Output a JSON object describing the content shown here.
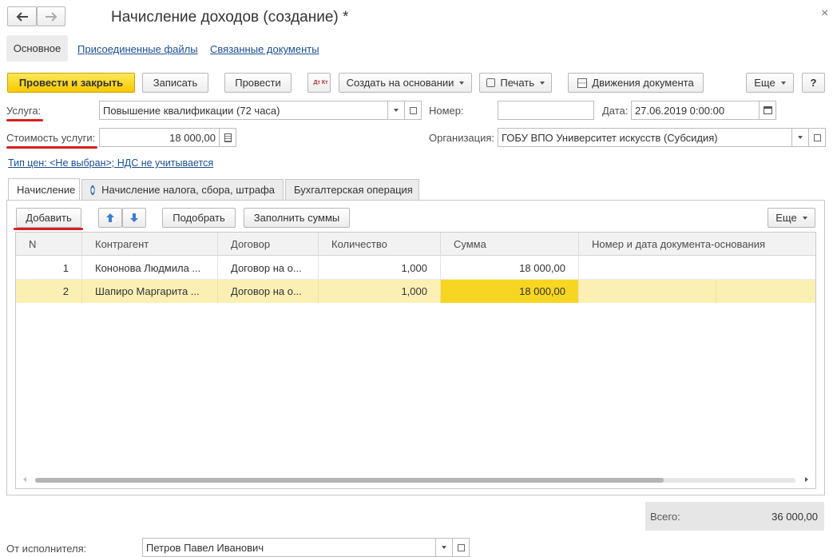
{
  "window": {
    "title": "Начисление доходов (создание) *",
    "back_icon": "arrow-left-icon",
    "forward_icon": "arrow-right-icon",
    "close_icon": "close-icon"
  },
  "nav_tabs": [
    "Основное",
    "Присоединенные файлы",
    "Связанные документы"
  ],
  "toolbar": {
    "post_close": "Провести и закрыть",
    "save": "Записать",
    "post": "Провести",
    "dt_kt_icon": "Дт Кт",
    "create_based": "Создать на основании",
    "print": "Печать",
    "movements": "Движения документа",
    "more": "Еще",
    "help": "?"
  },
  "form": {
    "service_label": "Услуга:",
    "service_value": "Повышение квалификации (72 часа)",
    "number_label": "Номер:",
    "number_value": "",
    "date_label": "Дата:",
    "date_value": "27.06.2019  0:00:00",
    "cost_label": "Стоимость услуги:",
    "cost_value": "18 000,00",
    "org_label": "Организация:",
    "org_value": "ГОБУ ВПО Университет искусств (Субсидия)",
    "price_link": "Тип цен: <Не выбран>; НДС не учитывается"
  },
  "content_tabs": [
    "Начисление",
    "Начисление налога, сбора, штрафа",
    "Бухгалтерская операция"
  ],
  "table_toolbar": {
    "add": "Добавить",
    "pick": "Подобрать",
    "fill_sums": "Заполнить суммы",
    "more": "Еще"
  },
  "table": {
    "columns": [
      "N",
      "Контрагент",
      "Договор",
      "Количество",
      "Сумма",
      "Номер и дата документа-основания"
    ],
    "rows": [
      {
        "n": "1",
        "counterparty": "Кононова Людмила ...",
        "contract": "Договор на о...",
        "quantity": "1,000",
        "sum": "18 000,00",
        "doc": ""
      },
      {
        "n": "2",
        "counterparty": "Шапиро Маргарита ...",
        "contract": "Договор на о...",
        "quantity": "1,000",
        "sum": "18 000,00",
        "doc": ""
      }
    ]
  },
  "totals": {
    "label": "Всего:",
    "value": "36 000,00"
  },
  "footer": {
    "executor_label": "От исполнителя:",
    "executor_value": "Петров Павел Иванович"
  },
  "colors": {
    "accent_yellow": "#f5c800",
    "selected_row": "#fbf0b4",
    "selected_cell": "#f6d622",
    "link_blue": "#1a4f8f",
    "annotation_red": "#d62020"
  }
}
